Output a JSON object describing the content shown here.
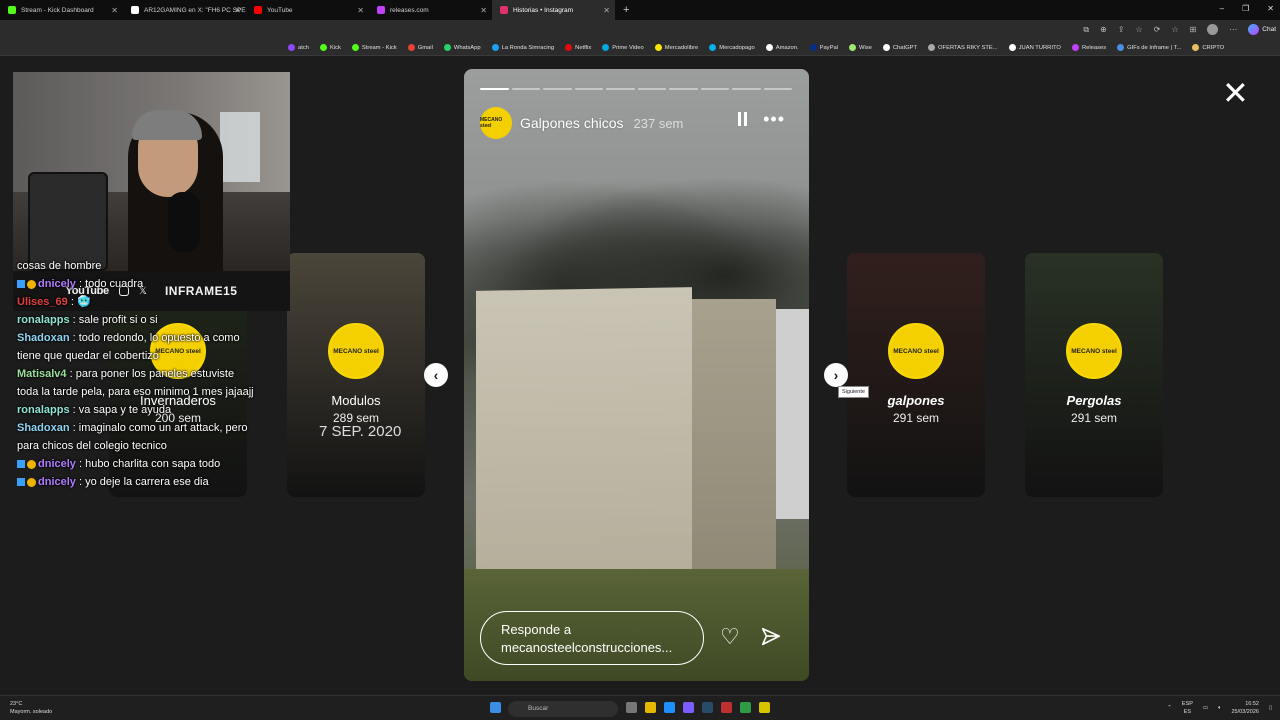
{
  "tabs": [
    {
      "label": "Stream - Kick Dashboard",
      "color": "#53fc18",
      "active": false
    },
    {
      "label": "AR12GAMING en X: \"FH6 PC SPEC...",
      "color": "#ffffff",
      "active": false
    },
    {
      "label": "YouTube",
      "color": "#ff0000",
      "active": false
    },
    {
      "label": "releases.com",
      "color": "#c040ff",
      "active": false
    },
    {
      "label": "Historias • Instagram",
      "color": "#e1306c",
      "active": true
    }
  ],
  "bookmarks": [
    {
      "label": "atch",
      "color": "#9146ff"
    },
    {
      "label": "Kick",
      "color": "#53fc18"
    },
    {
      "label": "Stream - Kick",
      "color": "#53fc18"
    },
    {
      "label": "Gmail",
      "color": "#ea4335"
    },
    {
      "label": "WhatsApp",
      "color": "#25d366"
    },
    {
      "label": "La Ronda Simracing",
      "color": "#1da1f2"
    },
    {
      "label": "Netflix",
      "color": "#e50914"
    },
    {
      "label": "Prime Video",
      "color": "#00a8e1"
    },
    {
      "label": "Mercadolibre",
      "color": "#ffe600"
    },
    {
      "label": "Mercadopago",
      "color": "#00b1ea"
    },
    {
      "label": "Amazon.",
      "color": "#ffffff"
    },
    {
      "label": "PayPal",
      "color": "#003087"
    },
    {
      "label": "Wise",
      "color": "#9fe870"
    },
    {
      "label": "ChatGPT",
      "color": "#ffffff"
    },
    {
      "label": "OFERTAS RIKY STE...",
      "color": "#aaaaaa"
    },
    {
      "label": "JUAN TURRITO",
      "color": "#ffffff"
    },
    {
      "label": "Releases",
      "color": "#c040ff"
    },
    {
      "label": "GIFs de Inframe | T...",
      "color": "#4a90e2"
    },
    {
      "label": "CRIPTO",
      "color": "#e8c060"
    }
  ],
  "browser": {
    "chat_label": "Chat"
  },
  "overlay": {
    "yt": "YouTube",
    "tw": "𝕏",
    "handle": "INFRAME15"
  },
  "chat": [
    {
      "user": "",
      "text": "cosas de hombre",
      "color": "#ffffff",
      "badges": false
    },
    {
      "user": "dnicely",
      "text": ": todo cuadra",
      "color": "#b07cff",
      "badges": true
    },
    {
      "user": "Ulises_69",
      "text": ": 🥶",
      "color": "#e04040",
      "badges": false
    },
    {
      "user": "ronalapps",
      "text": ": sale profit si o si",
      "color": "#8fe5d4",
      "badges": false
    },
    {
      "user": "Shadoxan",
      "text": ": todo redondo, lo opuesto a como tiene que quedar el cobertizo",
      "color": "#8fd4f0",
      "badges": false
    },
    {
      "user": "Matisalv4",
      "text": ": para poner los paneles estuviste toda la tarde pela, para eso minimo 1 mes jajaajj",
      "color": "#9be09b",
      "badges": false
    },
    {
      "user": "ronalapps",
      "text": ": va sapa y te ayuda",
      "color": "#8fe5d4",
      "badges": false
    },
    {
      "user": "Shadoxan",
      "text": ": imaginalo como un art attack, pero para chicos del colegio tecnico",
      "color": "#8fd4f0",
      "badges": false
    },
    {
      "user": "dnicely",
      "text": ": hubo charlita con sapa todo",
      "color": "#b07cff",
      "badges": true
    },
    {
      "user": "dnicely",
      "text": ": yo deje la carrera ese dia",
      "color": "#b07cff",
      "badges": true
    }
  ],
  "side_stories": [
    {
      "name": "Invernaderos",
      "age": "200 sem",
      "date": "",
      "bg": "#3e4a32"
    },
    {
      "name": "Modulos",
      "age": "289 sem",
      "date": "7 SEP. 2020",
      "bg": "#8a7f6a"
    },
    {
      "name": "galpones",
      "age": "291 sem",
      "date": "",
      "bg": "#5a3a35"
    },
    {
      "name": "Pergolas",
      "age": "291 sem",
      "date": "",
      "bg": "#4b5b42"
    }
  ],
  "story": {
    "logo": "MECANO steel",
    "name": "Galpones chicos",
    "time": "237 sem",
    "reply": "Responde a mecanosteelconstrucciones...",
    "segments_total": 10,
    "segments_done": 1
  },
  "nav": {
    "prev": "‹",
    "next": "›",
    "tooltip": "Siguiente",
    "close": "✕"
  },
  "taskbar": {
    "temp": "23°C",
    "weather": "Mayorm. soleado",
    "search": "Buscar",
    "lang1": "ESP",
    "lang2": "ES",
    "time": "16:52",
    "date": "25/03/2026"
  }
}
